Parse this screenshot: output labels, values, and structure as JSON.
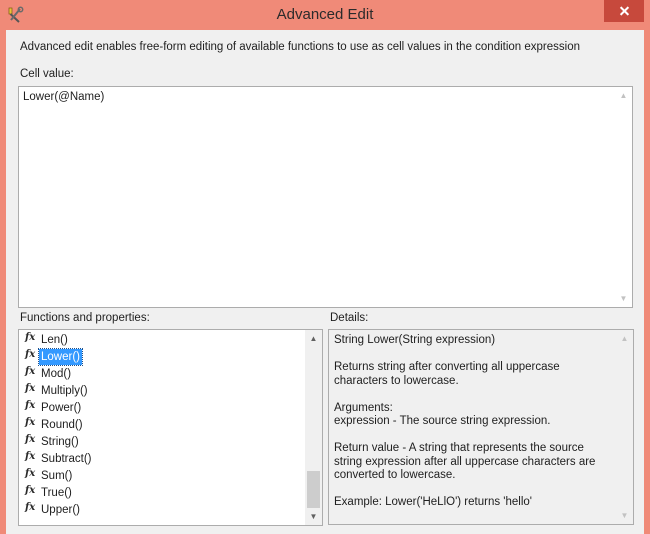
{
  "window": {
    "title": "Advanced Edit",
    "app_icon": "wrench-screwdriver-icon",
    "close_icon": "close-icon",
    "titlebar_color": "#f08a78",
    "close_color": "#c7493c"
  },
  "description": "Advanced edit enables free-form editing of available functions to use as cell values in the condition expression",
  "cell_value": {
    "label": "Cell value:",
    "value": "Lower(@Name)"
  },
  "functions": {
    "label": "Functions and properties:",
    "icon": "fx-icon",
    "selected": "Lower()",
    "selection_color": "#3399ff",
    "items": [
      "Len()",
      "Lower()",
      "Mod()",
      "Multiply()",
      "Power()",
      "Round()",
      "String()",
      "Subtract()",
      "Sum()",
      "True()",
      "Upper()"
    ]
  },
  "details": {
    "label": "Details:",
    "signature": "String Lower(String expression)",
    "summary": "Returns string after converting all uppercase characters to lowercase.",
    "arguments_heading": "Arguments:",
    "arguments": "expression - The source string expression.",
    "return_value": "Return value - A string that represents the source string expression after all uppercase characters are converted to lowercase.",
    "example": "Example: Lower('HeLlO') returns 'hello'"
  }
}
